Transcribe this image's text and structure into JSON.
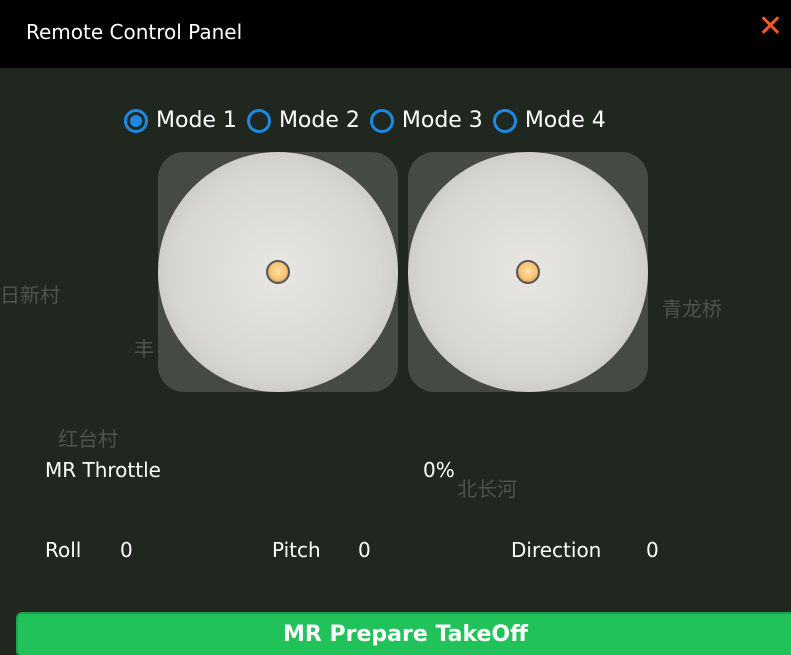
{
  "window": {
    "title": "Remote Control Panel",
    "close_icon": "close-icon"
  },
  "modes": [
    {
      "label": "Mode 1",
      "selected": true
    },
    {
      "label": "Mode 2",
      "selected": false
    },
    {
      "label": "Mode 3",
      "selected": false
    },
    {
      "label": "Mode 4",
      "selected": false
    }
  ],
  "map_labels": [
    "日新村",
    "丰",
    "青龙桥",
    "北长河",
    "红台村"
  ],
  "throttle": {
    "label": "MR Throttle",
    "value": "0%"
  },
  "telemetry": {
    "roll": {
      "label": "Roll",
      "value": "0"
    },
    "pitch": {
      "label": "Pitch",
      "value": "0"
    },
    "direction": {
      "label": "Direction",
      "value": "0"
    }
  },
  "action_button": {
    "label": "MR Prepare TakeOff"
  },
  "colors": {
    "accent": "#1e88e5",
    "close": "#ff5a1f",
    "button": "#22c25a"
  }
}
